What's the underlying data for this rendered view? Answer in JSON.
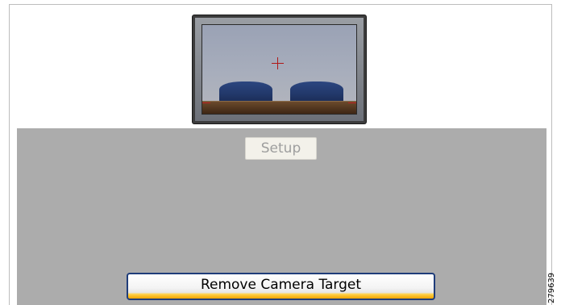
{
  "camera": {
    "setup_label": "Setup",
    "remove_target_label": "Remove Camera Target"
  },
  "figure_id": "279639",
  "icons": {
    "crosshair": "crosshair-icon"
  },
  "colors": {
    "panel_bg": "#acacac",
    "button_accent": "#f0a300",
    "button_border": "#1f3d7a",
    "crosshair": "#b01818"
  }
}
